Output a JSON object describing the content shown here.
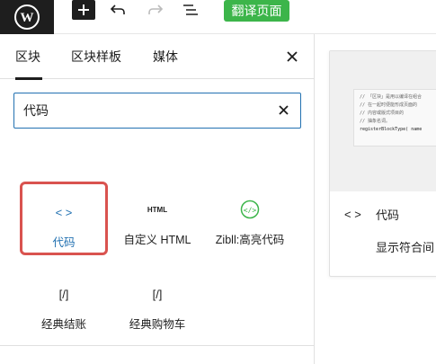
{
  "toolbar": {
    "logo_icon": "wordpress-icon",
    "add_icon": "plus-icon",
    "undo_icon": "undo-icon",
    "redo_icon": "redo-icon",
    "outline_icon": "list-view-icon",
    "translate_label": "翻译页面",
    "translate_color": "#3cb54a"
  },
  "inserter": {
    "tabs": [
      {
        "label": "区块",
        "active": true
      },
      {
        "label": "区块样板",
        "active": false
      },
      {
        "label": "媒体",
        "active": false
      }
    ],
    "search": {
      "value": "代码",
      "placeholder": ""
    },
    "results": [
      {
        "icon": "< >",
        "icon_name": "code-icon",
        "label": "代码",
        "selected": true
      },
      {
        "icon": "HTML",
        "icon_name": "html-icon",
        "label": "自定义 HTML",
        "selected": false
      },
      {
        "icon": "</>",
        "icon_name": "zibll-code-icon",
        "label": "Zibll:高亮代码",
        "selected": false
      },
      {
        "icon": "[/]",
        "icon_name": "shortcode-icon",
        "label": "经典结账",
        "selected": false
      },
      {
        "icon": "[/]",
        "icon_name": "shortcode-icon",
        "label": "经典购物车",
        "selected": false
      }
    ]
  },
  "preview": {
    "code_lines": [
      "// 「区块」是用以编译在组合",
      "// 在一起时便能形成页面的",
      "// 内容或版式项目的",
      "// 抽象名词。",
      "registerBlockType( name"
    ],
    "title": "代码",
    "description": "显示符合间"
  },
  "colors": {
    "accent": "#2271b1",
    "highlight_border": "#d9534f",
    "zibll_green": "#3cb54a"
  }
}
